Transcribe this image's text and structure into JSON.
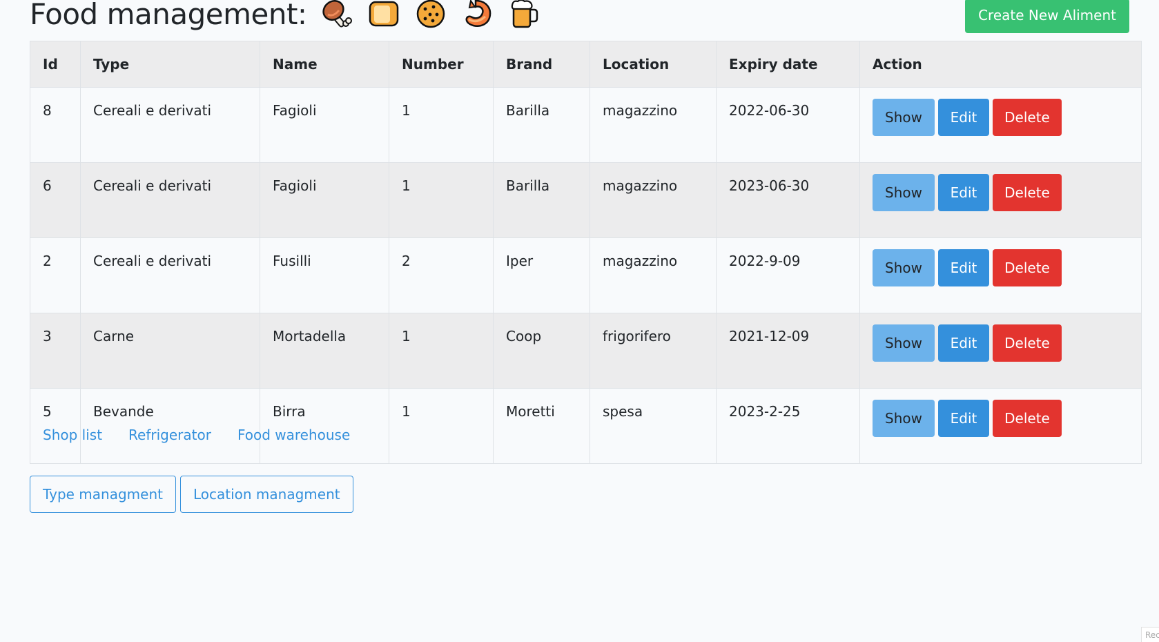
{
  "header": {
    "title": "Food management:",
    "emojis": [
      {
        "name": "meat-on-bone-icon",
        "glyph": "🍖"
      },
      {
        "name": "bread-icon",
        "glyph": "🍞"
      },
      {
        "name": "cookie-icon",
        "glyph": "🍪"
      },
      {
        "name": "shrimp-icon",
        "glyph": "🍤"
      },
      {
        "name": "beer-mug-icon",
        "glyph": "🍺"
      }
    ],
    "create_button": "Create New Aliment"
  },
  "table": {
    "columns": [
      "Id",
      "Type",
      "Name",
      "Number",
      "Brand",
      "Location",
      "Expiry date",
      "Action"
    ],
    "rows": [
      {
        "id": "8",
        "type": "Cereali e derivati",
        "name": "Fagioli",
        "number": "1",
        "brand": "Barilla",
        "location": "magazzino",
        "expiry": "2022-06-30"
      },
      {
        "id": "6",
        "type": "Cereali e derivati",
        "name": "Fagioli",
        "number": "1",
        "brand": "Barilla",
        "location": "magazzino",
        "expiry": "2023-06-30"
      },
      {
        "id": "2",
        "type": "Cereali e derivati",
        "name": "Fusilli",
        "number": "2",
        "brand": "Iper",
        "location": "magazzino",
        "expiry": "2022-9-09"
      },
      {
        "id": "3",
        "type": "Carne",
        "name": "Mortadella",
        "number": "1",
        "brand": "Coop",
        "location": "frigorifero",
        "expiry": "2021-12-09"
      },
      {
        "id": "5",
        "type": "Bevande",
        "name": "Birra",
        "number": "1",
        "brand": "Moretti",
        "location": "spesa",
        "expiry": "2023-2-25"
      }
    ],
    "actions": {
      "show": "Show",
      "edit": "Edit",
      "delete": "Delete"
    }
  },
  "links": [
    "Shop list",
    "Refrigerator",
    "Food warehouse"
  ],
  "management": {
    "type_button": "Type managment",
    "location_button": "Location managment"
  },
  "corner_text": "Rec",
  "colors": {
    "success": "#38c172",
    "info": "#6cb2eb",
    "primary": "#3490dc",
    "danger": "#e3342f",
    "background": "#f8fafc",
    "stripe": "#ececed"
  }
}
